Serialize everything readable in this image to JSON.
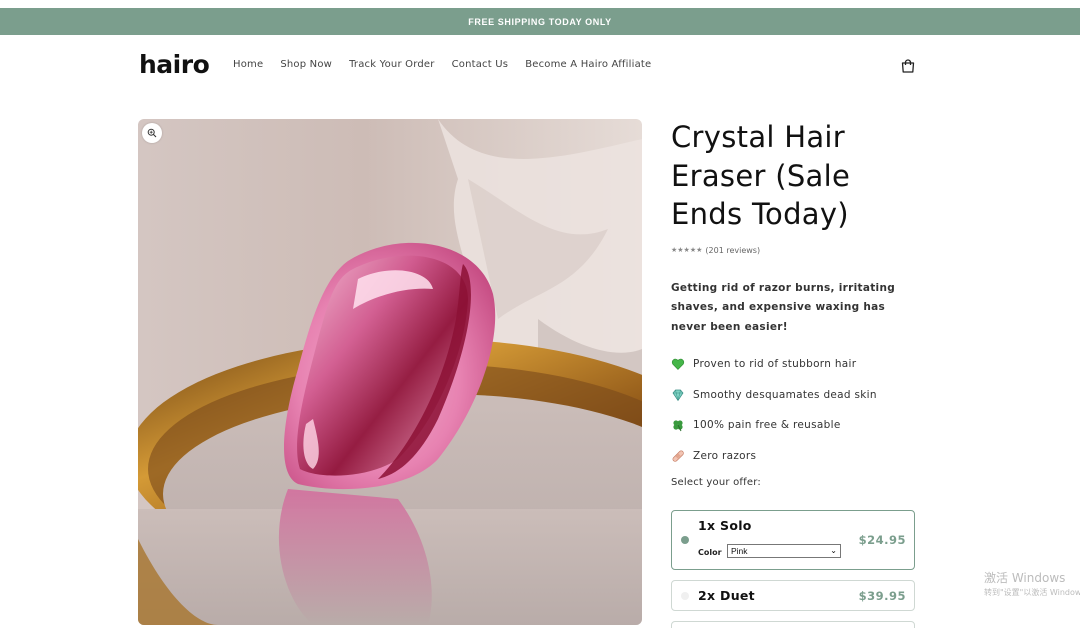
{
  "announcement": "FREE SHIPPING TODAY ONLY",
  "brand": {
    "logo": "hairo"
  },
  "nav": {
    "items": [
      "Home",
      "Shop Now",
      "Track Your Order",
      "Contact Us",
      "Become A Hairo Affiliate"
    ]
  },
  "product": {
    "title": "Crystal Hair Eraser (Sale Ends Today)",
    "stars": "★★★★★",
    "reviews": "(201 reviews)",
    "description": "Getting rid of razor burns, irritating shaves, and expensive waxing has never been easier!",
    "benefits": [
      {
        "icon": "green-heart-icon",
        "text": "Proven to rid of stubborn hair"
      },
      {
        "icon": "gem-icon",
        "text": "Smoothy desquamates dead skin"
      },
      {
        "icon": "four-leaf-clover-icon",
        "text": "100% pain free & reusable"
      },
      {
        "icon": "bandage-icon",
        "text": "Zero razors"
      }
    ],
    "offer_label": "Select your offer:",
    "offers": [
      {
        "name": "1x Solo",
        "price": "$24.95",
        "color_label": "Color",
        "color_value": "Pink",
        "selected": true
      },
      {
        "name": "2x Duet",
        "price": "$39.95",
        "selected": false
      }
    ]
  },
  "watermark": {
    "line1": "激活 Windows",
    "line2": "转到\"设置\"以激活 Windows。"
  },
  "colors": {
    "accent": "#7b9e8d",
    "announcement_bg": "#7b9e8d"
  }
}
